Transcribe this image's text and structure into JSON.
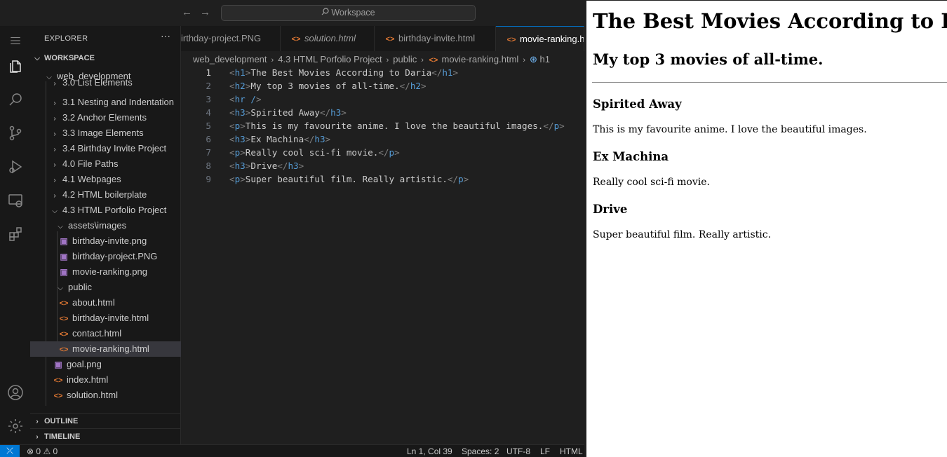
{
  "titlebar": {
    "search_placeholder": "Workspace",
    "back_arrow": "←",
    "forward_arrow": "→"
  },
  "activitybar": {
    "icons": [
      "explorer-icon",
      "search-icon",
      "source-control-icon",
      "run-debug-icon",
      "remote-explorer-icon",
      "extensions-icon",
      "accounts-icon",
      "settings-gear-icon"
    ]
  },
  "sidebar": {
    "title": "EXPLORER",
    "more": "···",
    "workspace_label": "WORKSPACE",
    "outline_label": "OUTLINE",
    "timeline_label": "TIMELINE",
    "tree": [
      {
        "label": "web_development",
        "type": "folder-open"
      },
      {
        "label": "3.0 List Elements",
        "type": "folder"
      },
      {
        "label": "3.1 Nesting and Indentation",
        "type": "folder"
      },
      {
        "label": "3.2 Anchor Elements",
        "type": "folder"
      },
      {
        "label": "3.3 Image Elements",
        "type": "folder"
      },
      {
        "label": "3.4 Birthday Invite Project",
        "type": "folder"
      },
      {
        "label": "4.0 File Paths",
        "type": "folder"
      },
      {
        "label": "4.1 Webpages",
        "type": "folder"
      },
      {
        "label": "4.2 HTML boilerplate",
        "type": "folder"
      },
      {
        "label": "4.3 HTML Porfolio Project",
        "type": "folder-open"
      },
      {
        "label": "assets\\images",
        "type": "folder-open"
      },
      {
        "label": "birthday-invite.png",
        "type": "image"
      },
      {
        "label": "birthday-project.PNG",
        "type": "image"
      },
      {
        "label": "movie-ranking.png",
        "type": "image"
      },
      {
        "label": "public",
        "type": "folder-open"
      },
      {
        "label": "about.html",
        "type": "html"
      },
      {
        "label": "birthday-invite.html",
        "type": "html"
      },
      {
        "label": "contact.html",
        "type": "html"
      },
      {
        "label": "movie-ranking.html",
        "type": "html"
      },
      {
        "label": "goal.png",
        "type": "image"
      },
      {
        "label": "index.html",
        "type": "html"
      },
      {
        "label": "solution.html",
        "type": "html"
      }
    ]
  },
  "tabs": [
    {
      "label": "irthday-project.PNG",
      "icon": "image",
      "active": false,
      "italic": false
    },
    {
      "label": "solution.html",
      "icon": "html",
      "active": false,
      "italic": true
    },
    {
      "label": "birthday-invite.html",
      "icon": "html",
      "active": false,
      "italic": false
    },
    {
      "label": "movie-ranking.h",
      "icon": "html",
      "active": true,
      "italic": false
    }
  ],
  "breadcrumb": {
    "parts": [
      "web_development",
      "4.3 HTML Porfolio Project",
      "public",
      "movie-ranking.html",
      "h1"
    ],
    "separator": "›"
  },
  "code": {
    "current_line": 1,
    "lines": [
      {
        "n": "1",
        "tag": "h1",
        "text": "The Best Movies According to Daria",
        "close": "h1"
      },
      {
        "n": "2",
        "tag": "h2",
        "text": "My top 3 movies of all-time.",
        "close": "h2"
      },
      {
        "n": "3",
        "tag": "hr /",
        "text": "",
        "close": ""
      },
      {
        "n": "4",
        "tag": "h3",
        "text": "Spirited Away",
        "close": "h3"
      },
      {
        "n": "5",
        "tag": "p",
        "text": "This is my favourite anime. I love the beautiful images.",
        "close": "p"
      },
      {
        "n": "6",
        "tag": "h3",
        "text": "Ex Machina",
        "close": "h3"
      },
      {
        "n": "7",
        "tag": "p",
        "text": "Really cool sci-fi movie.",
        "close": "p"
      },
      {
        "n": "8",
        "tag": "h3",
        "text": "Drive",
        "close": "h3"
      },
      {
        "n": "9",
        "tag": "p",
        "text": "Super beautiful film. Really artistic.",
        "close": "p"
      }
    ]
  },
  "statusbar": {
    "remote": "⤫",
    "errors": "0",
    "warnings": "0",
    "position": "Ln 1, Col 39",
    "spaces": "Spaces: 2",
    "encoding": "UTF-8",
    "eol": "LF",
    "language": "HTML"
  },
  "preview": {
    "h1": "The Best Movies According to Daria",
    "h2": "My top 3 movies of all-time.",
    "movies": [
      {
        "title": "Spirited Away",
        "desc": "This is my favourite anime. I love the beautiful images."
      },
      {
        "title": "Ex Machina",
        "desc": "Really cool sci-fi movie."
      },
      {
        "title": "Drive",
        "desc": "Super beautiful film. Really artistic."
      }
    ]
  },
  "colors": {
    "accent": "#0078d4",
    "html_icon": "#e37933",
    "image_icon": "#a074c4",
    "tag": "#569cd6"
  }
}
